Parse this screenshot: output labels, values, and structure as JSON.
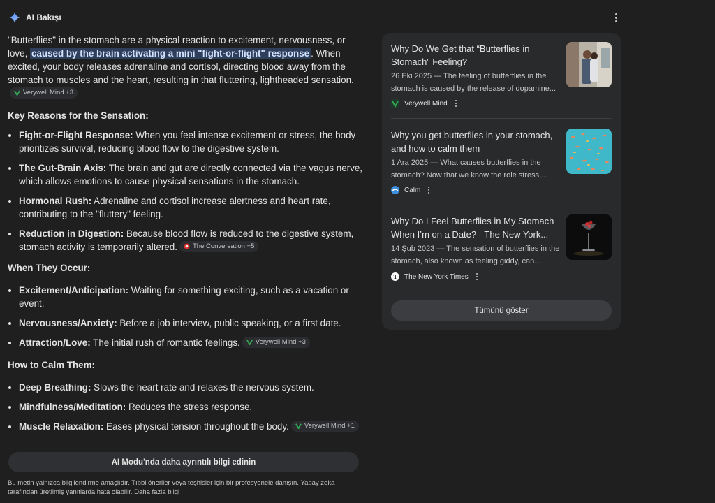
{
  "header": {
    "title": "AI Bakışı",
    "icon": "sparkle-icon",
    "accent": "#8ab4f8"
  },
  "intro": {
    "before": "\"Butterflies\" in the stomach are a physical reaction to excitement, nervousness, or love, ",
    "highlight": "caused by the brain activating a mini \"fight-or-flight\" response",
    "after": ". When excited, your body releases adrenaline and cortisol, directing blood away from the stomach to muscles and the heart, resulting in that fluttering, lightheaded sensation.",
    "chip": "Verywell Mind +3"
  },
  "sections": [
    {
      "heading": "Key Reasons for the Sensation:",
      "items": [
        {
          "term": "Fight-or-Flight Response:",
          "text": " When you feel intense excitement or stress, the body prioritizes survival, reducing blood flow to the digestive system."
        },
        {
          "term": "The Gut-Brain Axis:",
          "text": " The brain and gut are directly connected via the vagus nerve, which allows emotions to cause physical sensations in the stomach."
        },
        {
          "term": "Hormonal Rush:",
          "text": " Adrenaline and cortisol increase alertness and heart rate, contributing to the \"fluttery\" feeling."
        },
        {
          "term": "Reduction in Digestion:",
          "text": " Because blood flow is reduced to the digestive system, stomach activity is temporarily altered.",
          "chip": "The Conversation +5"
        }
      ]
    },
    {
      "heading": "When They Occur:",
      "items": [
        {
          "term": "Excitement/Anticipation:",
          "text": " Waiting for something exciting, such as a vacation or event."
        },
        {
          "term": "Nervousness/Anxiety:",
          "text": " Before a job interview, public speaking, or a first date."
        },
        {
          "term": "Attraction/Love:",
          "text": " The initial rush of romantic feelings.",
          "chip": "Verywell Mind +3"
        }
      ]
    },
    {
      "heading": "How to Calm Them:",
      "items": [
        {
          "term": "Deep Breathing:",
          "text": " Slows the heart rate and relaxes the nervous system."
        },
        {
          "term": "Mindfulness/Meditation:",
          "text": " Reduces the stress response."
        },
        {
          "term": "Muscle Relaxation:",
          "text": " Eases physical tension throughout the body.",
          "chip": "Verywell Mind +1"
        }
      ]
    }
  ],
  "ai_mode_button": "AI Modu'nda daha ayrıntılı bilgi edinin",
  "disclaimer": {
    "text": "Bu metin yalnızca bilgilendirme amaçlıdır. Tıbbi öneriler veya teşhisler için bir profesyonele danışın. Yapay zeka tarafından üretilmiş yanıtlarda hata olabilir. ",
    "link": "Daha fazla bilgi"
  },
  "sources": [
    {
      "title": "Why Do We Get that “Butterflies in Stomach” Feeling?",
      "snippet": "26 Eki 2025 — The feeling of butterflies in the stomach is caused by the release of dopamine...",
      "source": "Verywell Mind",
      "favicon": "verywell-favicon-icon"
    },
    {
      "title": "Why you get butterflies in your stomach, and how to calm them",
      "snippet": "1 Ara 2025 — What causes butterflies in the stomach? Now that we know the role stress,...",
      "source": "Calm",
      "favicon": "calm-favicon-icon"
    },
    {
      "title": "Why Do I Feel Butterflies in My Stomach When I’m on a Date? - The New York...",
      "snippet": "14 Şub 2023 — The sensation of butterflies in the stomach, also known as feeling giddy, can...",
      "source": "The New York Times",
      "favicon": "nyt-favicon-icon"
    }
  ],
  "show_all": "Tümünü göster"
}
